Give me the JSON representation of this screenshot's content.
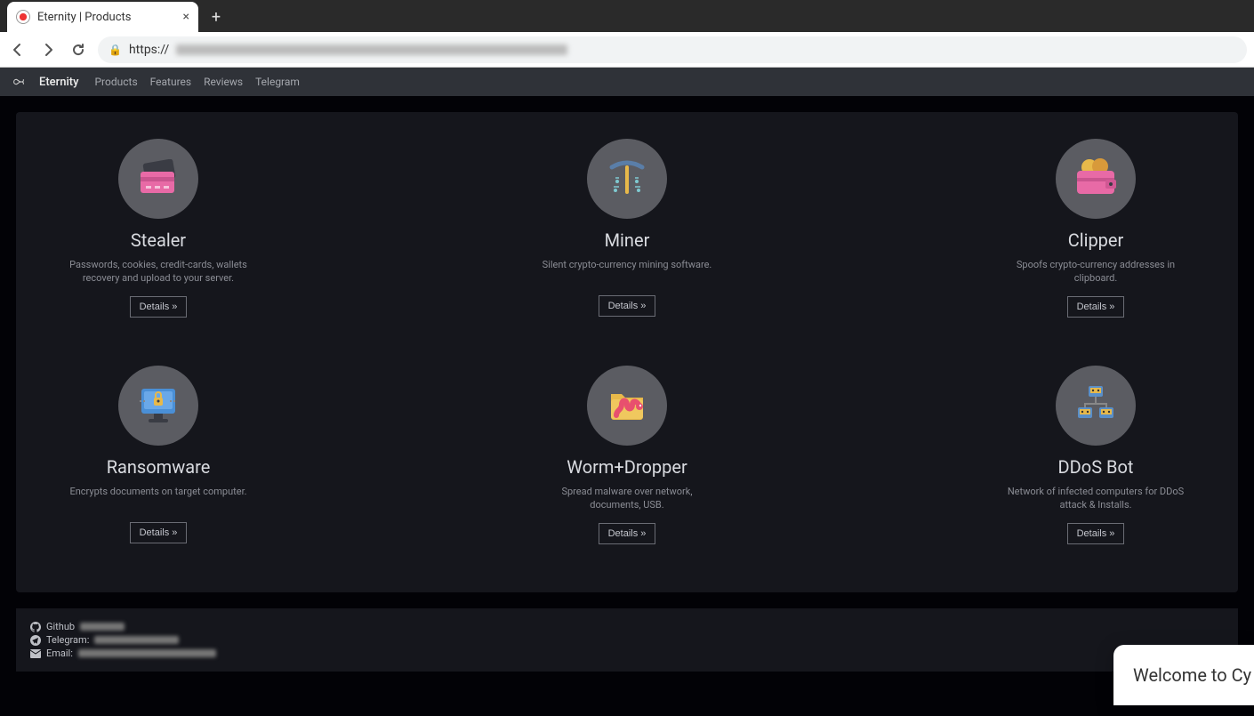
{
  "browser": {
    "tab_title": "Eternity | Products",
    "url_prefix": "https://"
  },
  "nav": {
    "brand": "Eternity",
    "links": [
      "Products",
      "Features",
      "Reviews",
      "Telegram"
    ]
  },
  "products": [
    {
      "title": "Stealer",
      "desc": "Passwords, cookies, credit-cards, wallets recovery and upload to your server.",
      "button": "Details »",
      "icon": "credit-card-icon"
    },
    {
      "title": "Miner",
      "desc": "Silent crypto-currency mining software.",
      "button": "Details »",
      "icon": "pickaxe-icon"
    },
    {
      "title": "Clipper",
      "desc": "Spoofs crypto-currency addresses in clipboard.",
      "button": "Details »",
      "icon": "wallet-icon"
    },
    {
      "title": "Ransomware",
      "desc": "Encrypts documents on target computer.",
      "button": "Details »",
      "icon": "locked-monitor-icon"
    },
    {
      "title": "Worm+Dropper",
      "desc": "Spread malware over network, documents, USB.",
      "button": "Details »",
      "icon": "worm-folder-icon"
    },
    {
      "title": "DDoS Bot",
      "desc": "Network of infected computers for DDoS attack & Installs.",
      "button": "Details »",
      "icon": "botnet-icon"
    }
  ],
  "footer": {
    "github_label": "Github",
    "telegram_label": "Telegram:",
    "email_label": "Email:"
  },
  "welcome": "Welcome to Cy"
}
